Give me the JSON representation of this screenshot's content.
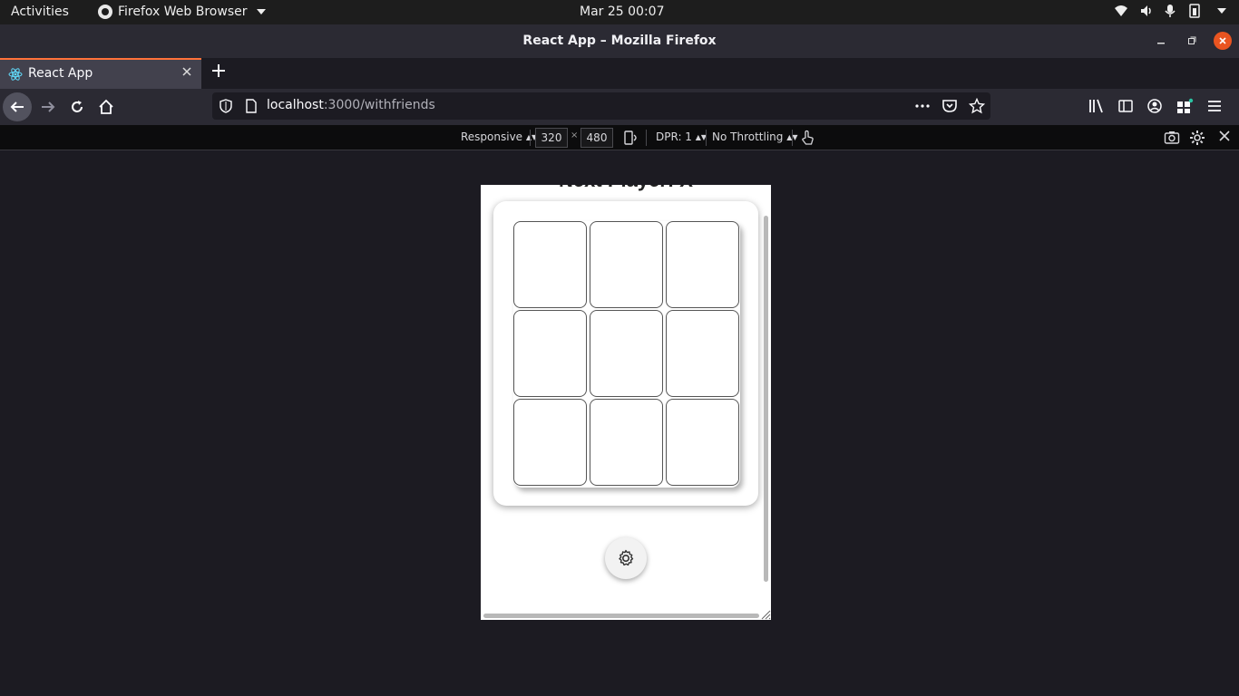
{
  "system": {
    "activities": "Activities",
    "app_menu": "Firefox Web Browser",
    "clock": "Mar 25  00:07"
  },
  "window": {
    "title": "React App – Mozilla Firefox"
  },
  "tab": {
    "title": "React App"
  },
  "urlbar": {
    "host": "localhost",
    "path": ":3000/withfriends"
  },
  "rdm": {
    "device": "Responsive",
    "width": "320",
    "height": "480",
    "times": "×",
    "dpr": "DPR: 1",
    "throttling": "No Throttling"
  },
  "page": {
    "heading": "Next Player: X",
    "board_cells": [
      "",
      "",
      "",
      "",
      "",
      "",
      "",
      "",
      ""
    ],
    "settings_icon": "gear-icon"
  },
  "colors": {
    "accent_tab": "#ff7139",
    "close_button": "#e95420",
    "page_background": "#1c1b22"
  }
}
